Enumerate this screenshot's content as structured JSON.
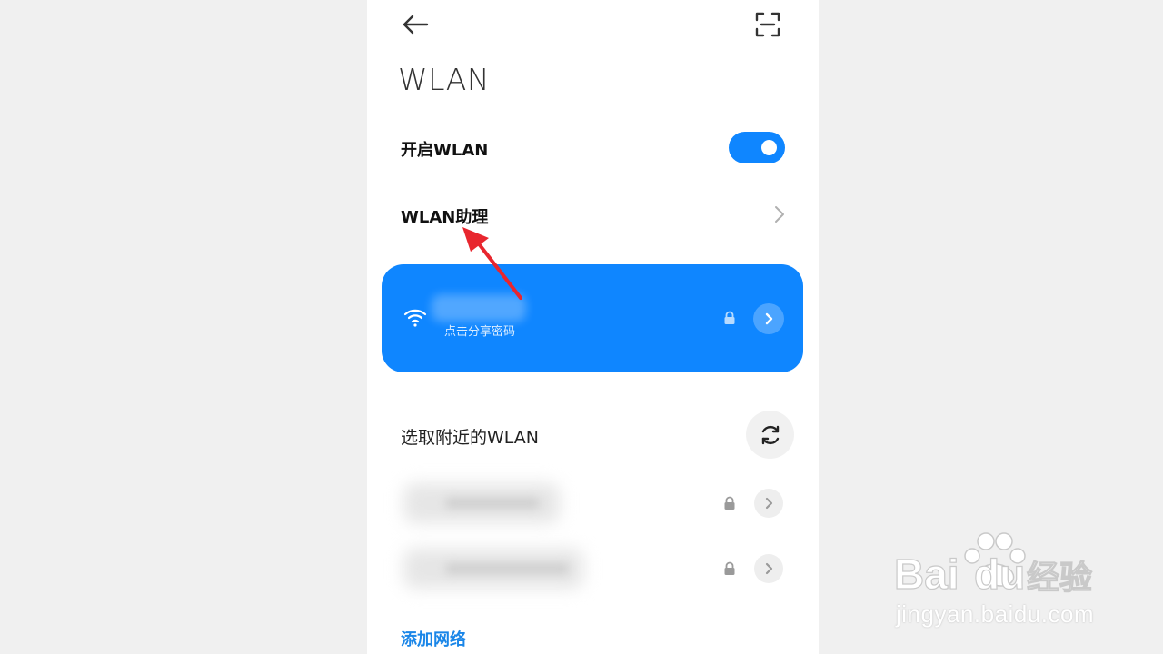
{
  "colors": {
    "accent": "#0f86ff",
    "link": "#1a86e8",
    "annotation": "#e8262e"
  },
  "header": {
    "back_icon": "arrow-left-icon",
    "scan_icon": "scan-frame-icon",
    "title": "WLAN"
  },
  "settings": {
    "enable_wlan_label": "开启WLAN",
    "enable_wlan_on": true,
    "assistant_label": "WLAN助理"
  },
  "connected": {
    "subtitle": "点击分享密码",
    "wifi_icon": "wifi-icon",
    "lock_icon": "lock-icon",
    "detail_icon": "chevron-right-icon"
  },
  "nearby": {
    "title": "选取附近的WLAN",
    "refresh_icon": "refresh-icon",
    "networks": [
      {
        "secured": true
      },
      {
        "secured": true
      }
    ]
  },
  "add_network_label": "添加网络",
  "watermark": {
    "logo": "Baidu经验",
    "url": "jingyan.baidu.com"
  }
}
